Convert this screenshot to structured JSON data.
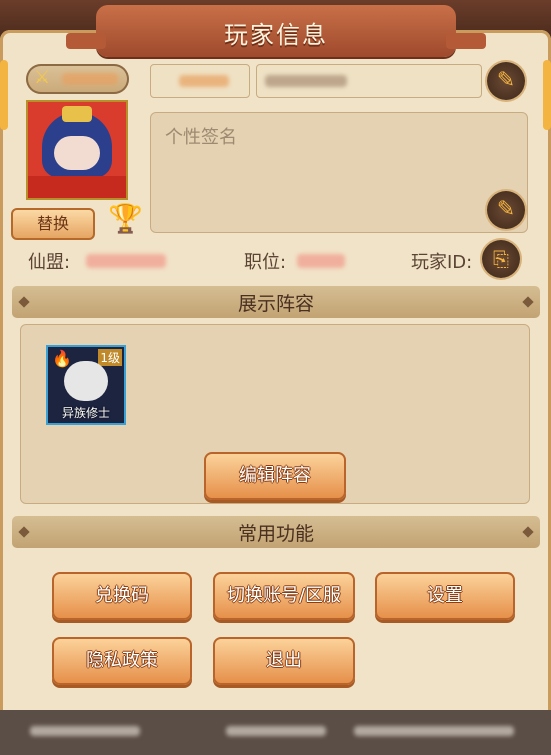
{
  "header": {
    "title": "玩家信息"
  },
  "profile": {
    "signature_placeholder": "个性签名",
    "swap_label": "替换",
    "alliance_label": "仙盟:",
    "position_label": "职位:",
    "player_id_label": "玩家ID:"
  },
  "lineup": {
    "section_title": "展示阵容",
    "hero": {
      "level": "1级",
      "name": "异族修士"
    },
    "edit_label": "编辑阵容"
  },
  "functions": {
    "section_title": "常用功能",
    "buttons": [
      "兑换码",
      "切换账号/区服",
      "设置",
      "隐私政策",
      "退出"
    ]
  },
  "icons": [
    "edit-icon",
    "trophy-icon",
    "player-id-icon",
    "fire-icon"
  ],
  "colors": {
    "accent": "#e6904a",
    "panel": "#f1e3c8",
    "header": "#b55a36"
  }
}
